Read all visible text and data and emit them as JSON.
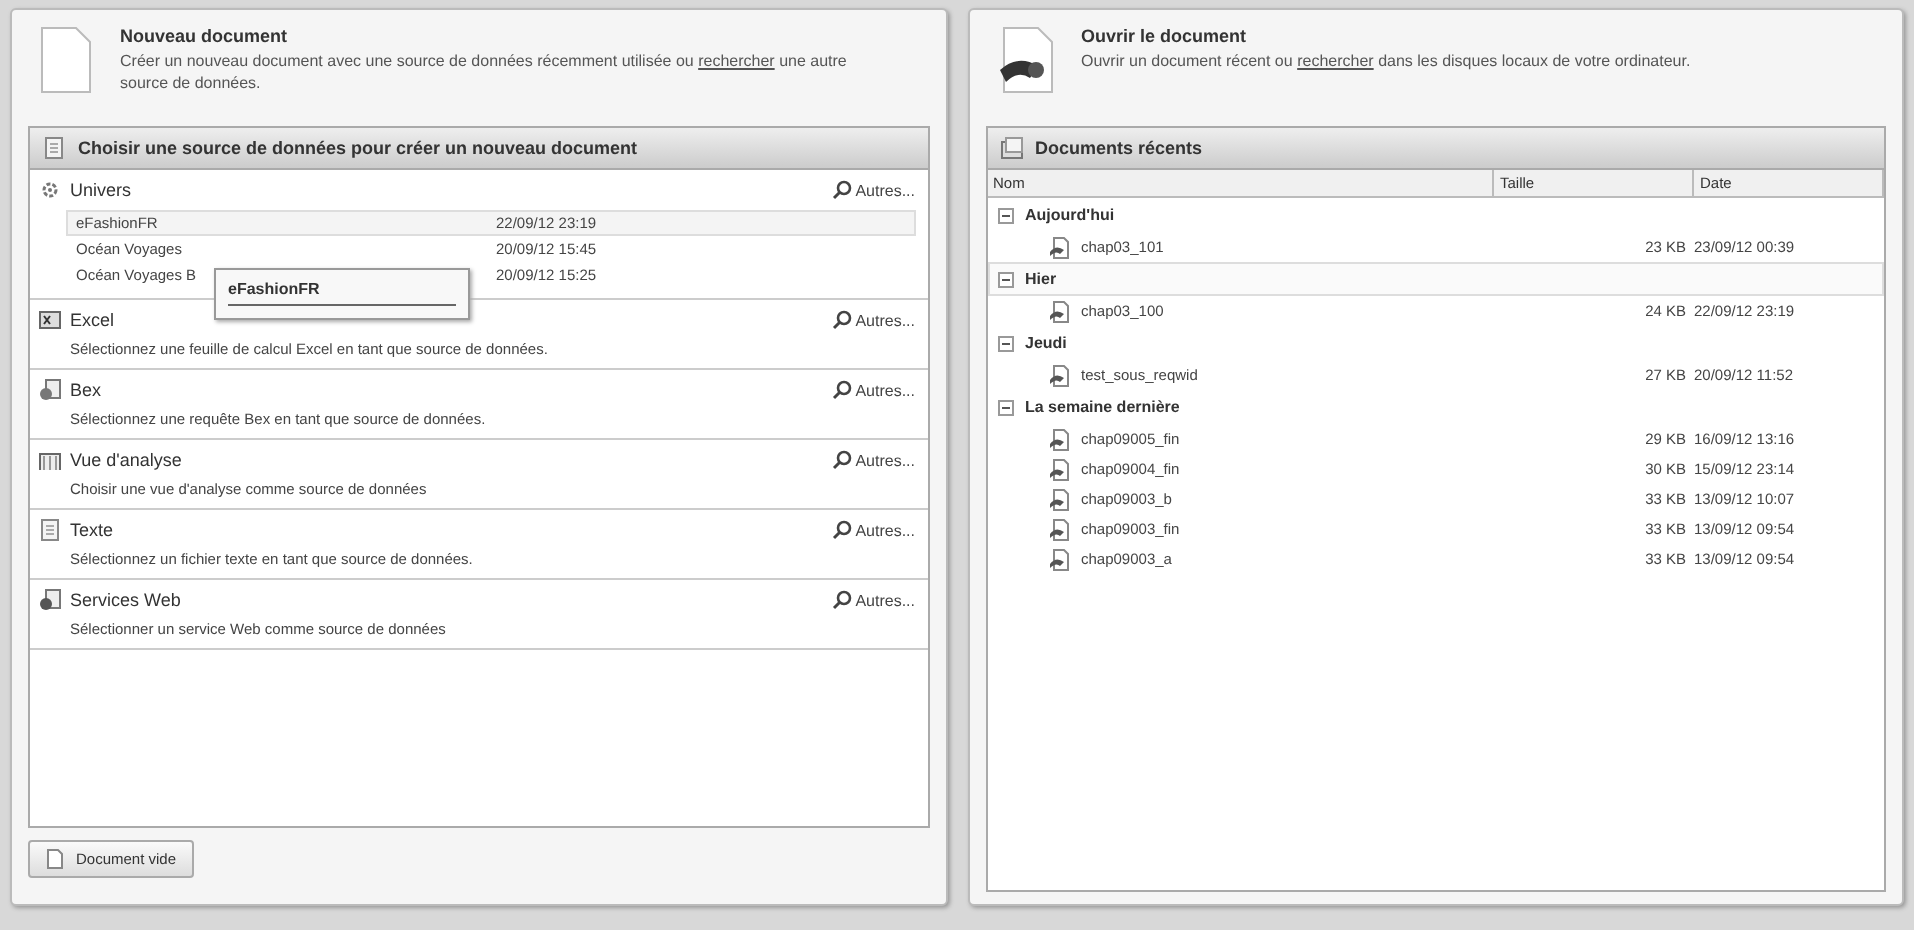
{
  "new_document": {
    "title": "Nouveau document",
    "description_before": "Créer un nouveau document avec une source de données récemment utilisée ou",
    "link": "rechercher",
    "description_after": "une autre source de données.",
    "panel_title": "Choisir une source de données pour créer un nouveau document",
    "sources": [
      {
        "kind": "list",
        "name": "Univers",
        "more": "Autres...",
        "items": [
          {
            "name": "eFashionFR",
            "date": "22/09/12 23:19",
            "selected": true
          },
          {
            "name": "Océan Voyages",
            "date": "20/09/12 15:45",
            "selected": false
          },
          {
            "name": "Océan Voyages B",
            "date": "20/09/12 15:25",
            "selected": false
          }
        ],
        "tooltip": "eFashionFR"
      },
      {
        "kind": "plain",
        "name": "Excel",
        "more": "Autres...",
        "description": "Sélectionnez une feuille de calcul Excel en tant que source de données."
      },
      {
        "kind": "plain",
        "name": "Bex",
        "more": "Autres...",
        "description": "Sélectionnez une requête Bex en tant que source de données."
      },
      {
        "kind": "plain",
        "name": "Vue d'analyse",
        "more": "Autres...",
        "description": "Choisir une vue d'analyse comme source de données"
      },
      {
        "kind": "plain",
        "name": "Texte",
        "more": "Autres...",
        "description": "Sélectionnez un fichier texte en tant que source de données."
      },
      {
        "kind": "plain",
        "name": "Services Web",
        "more": "Autres...",
        "description": "Sélectionner un service Web comme source de données"
      }
    ],
    "button": "Document vide"
  },
  "open_document": {
    "title": "Ouvrir le document",
    "description_before": "Ouvrir un document récent ou",
    "link": "rechercher",
    "description_after": "dans les disques locaux de votre ordinateur.",
    "panel_title": "Documents récents",
    "columns": [
      "Nom",
      "Taille",
      "Date"
    ],
    "groups": [
      {
        "name": "Aujourd'hui",
        "expanded": true,
        "selected": false,
        "children": [
          {
            "name": "chap03_101",
            "size": "23 KB",
            "date": "23/09/12 00:39"
          }
        ]
      },
      {
        "name": "Hier",
        "expanded": true,
        "selected": true,
        "children": [
          {
            "name": "chap03_100",
            "size": "24 KB",
            "date": "22/09/12 23:19"
          }
        ]
      },
      {
        "name": "Jeudi",
        "expanded": true,
        "selected": false,
        "children": [
          {
            "name": "test_sous_reqwid",
            "size": "27 KB",
            "date": "20/09/12 11:52"
          }
        ]
      },
      {
        "name": "La semaine dernière",
        "expanded": true,
        "selected": false,
        "children": [
          {
            "name": "chap09005_fin",
            "size": "29 KB",
            "date": "16/09/12 13:16"
          },
          {
            "name": "chap09004_fin",
            "size": "30 KB",
            "date": "15/09/12 23:14"
          },
          {
            "name": "chap09003_b",
            "size": "33 KB",
            "date": "13/09/12 10:07"
          },
          {
            "name": "chap09003_fin",
            "size": "33 KB",
            "date": "13/09/12 09:54"
          },
          {
            "name": "chap09003_a",
            "size": "33 KB",
            "date": "13/09/12 09:54"
          }
        ]
      }
    ]
  }
}
